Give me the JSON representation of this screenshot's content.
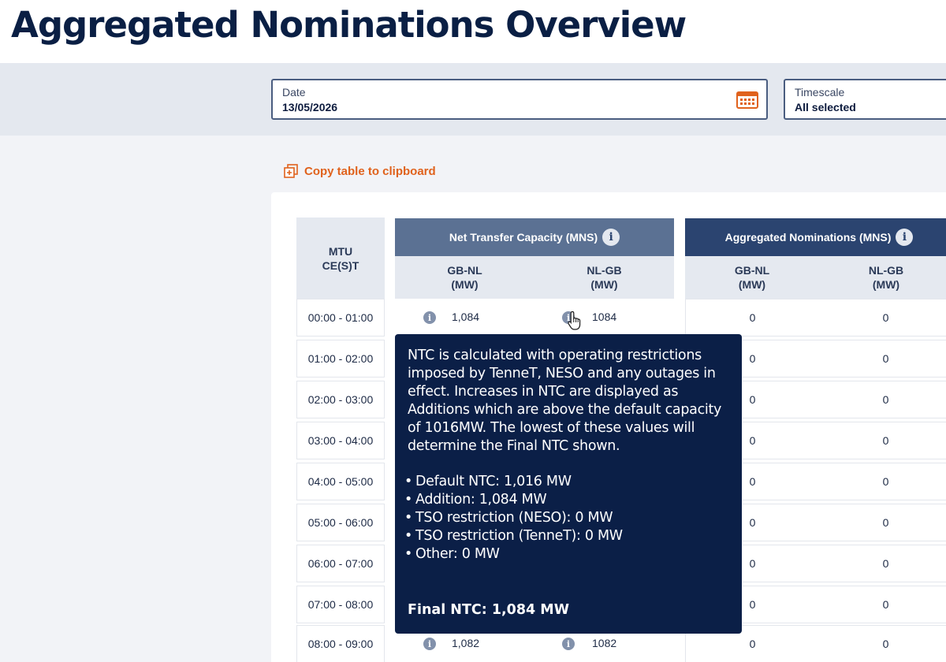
{
  "page": {
    "title": "Aggregated Nominations Overview"
  },
  "filters": {
    "date_label": "Date",
    "date_value": "13/05/2026",
    "timescale_label": "Timescale",
    "timescale_value": "All selected"
  },
  "actions": {
    "copy_label": "Copy table to clipboard"
  },
  "table": {
    "mtu_header_line1": "MTU",
    "mtu_header_line2": "CE(S)T",
    "ntc_group": "Net Transfer Capacity (MNS)",
    "agg_group": "Aggregated Nominations (MNS)",
    "sub_headers": [
      {
        "line1": "GB-NL",
        "line2": "(MW)"
      },
      {
        "line1": "NL-GB",
        "line2": "(MW)"
      },
      {
        "line1": "GB-NL",
        "line2": "(MW)"
      },
      {
        "line1": "NL-GB",
        "line2": "(MW)"
      }
    ],
    "info_glyph": "i",
    "rows": [
      {
        "mtu": "00:00 - 01:00",
        "ntc_gbnl": "1,084",
        "ntc_nlgb": "1084",
        "agg_gbnl": "0",
        "agg_nlgb": "0"
      },
      {
        "mtu": "01:00 - 02:00",
        "agg_gbnl": "0",
        "agg_nlgb": "0"
      },
      {
        "mtu": "02:00 - 03:00",
        "agg_gbnl": "0",
        "agg_nlgb": "0"
      },
      {
        "mtu": "03:00 - 04:00",
        "agg_gbnl": "0",
        "agg_nlgb": "0"
      },
      {
        "mtu": "04:00 - 05:00",
        "agg_gbnl": "0",
        "agg_nlgb": "0"
      },
      {
        "mtu": "05:00 - 06:00",
        "agg_gbnl": "0",
        "agg_nlgb": "0"
      },
      {
        "mtu": "06:00 - 07:00",
        "agg_gbnl": "0",
        "agg_nlgb": "0"
      },
      {
        "mtu": "07:00 - 08:00",
        "agg_gbnl": "0",
        "agg_nlgb": "0"
      },
      {
        "mtu": "08:00 - 09:00",
        "ntc_gbnl": "1,082",
        "ntc_nlgb": "1082",
        "agg_gbnl": "0",
        "agg_nlgb": "0"
      }
    ]
  },
  "tooltip": {
    "body": "NTC is calculated with operating restrictions imposed by TenneT, NESO and any outages in effect. Increases in NTC are displayed as Additions which are above the default capacity of 1016MW. The lowest of these values will determine the Final NTC shown.",
    "items": [
      "Default NTC: 1,016 MW",
      "Addition: 1,084 MW",
      "TSO restriction (NESO): 0 MW",
      "TSO restriction (TenneT): 0 MW",
      "Other: 0 MW"
    ],
    "final": "Final NTC: 1,084 MW"
  },
  "colors": {
    "accent_orange": "#e0621d",
    "navy": "#0b1f47",
    "ntc_header": "#5b7193",
    "agg_header": "#2b4470"
  },
  "icons": {
    "calendar": "calendar-icon",
    "copy": "copy-icon",
    "info": "info-icon",
    "cursor": "hand-cursor-icon"
  }
}
